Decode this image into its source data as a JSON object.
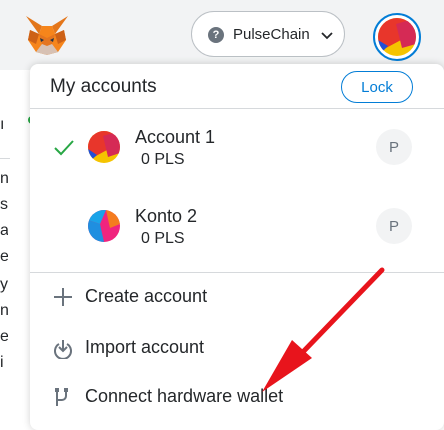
{
  "header": {
    "network_label": "PulseChain",
    "network_icon": "question-icon"
  },
  "menu": {
    "title": "My accounts",
    "lock_label": "Lock",
    "accounts": [
      {
        "name": "Account 1",
        "balance": "0 PLS",
        "selected": true,
        "badge": "P"
      },
      {
        "name": "Konto 2",
        "balance": "0 PLS",
        "selected": false,
        "badge": "P"
      }
    ],
    "actions": [
      {
        "label": "Create account",
        "icon": "plus-icon"
      },
      {
        "label": "Import account",
        "icon": "import-icon"
      },
      {
        "label": "Connect hardware wallet",
        "icon": "hardware-wallet-icon"
      }
    ]
  },
  "background": {
    "letters": [
      "ı",
      "",
      "n",
      "s",
      "a",
      "e",
      "y",
      "n",
      "e",
      "i"
    ]
  },
  "colors": {
    "accent": "#037dd6",
    "check": "#28a745",
    "arrow": "#e8141c",
    "topbar": "#f2f3f4"
  }
}
